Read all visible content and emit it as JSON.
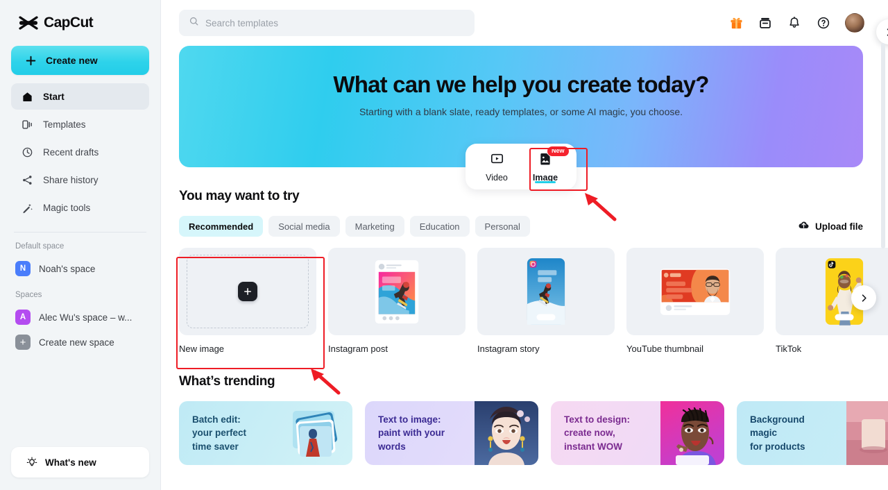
{
  "brand": {
    "name": "CapCut",
    "logo_icon": "capcut-logo-icon"
  },
  "sidebar": {
    "create_new": {
      "label": "Create new",
      "icon": "plus-icon"
    },
    "nav": [
      {
        "label": "Start",
        "icon": "home-icon",
        "active": true
      },
      {
        "label": "Templates",
        "icon": "templates-icon",
        "active": false
      },
      {
        "label": "Recent drafts",
        "icon": "clock-icon",
        "active": false
      },
      {
        "label": "Share history",
        "icon": "share-icon",
        "active": false
      },
      {
        "label": "Magic tools",
        "icon": "magic-wand-icon",
        "active": false
      }
    ],
    "default_space_label": "Default space",
    "default_space": {
      "label": "Noah's space",
      "initial": "N",
      "color": "#4a7dfb"
    },
    "spaces_label": "Spaces",
    "spaces": [
      {
        "label": "Alec Wu's space – w...",
        "initial": "A",
        "color": "#b44cf0"
      },
      {
        "label": "Create new space",
        "initial": "+",
        "color": "#8a9099"
      }
    ],
    "whats_new": {
      "label": "What's new",
      "icon": "lightbulb-icon"
    }
  },
  "header": {
    "search": {
      "placeholder": "Search templates",
      "value": "",
      "icon": "search-icon"
    },
    "actions": [
      {
        "name": "gift-icon",
        "label": "Gift"
      },
      {
        "name": "archive-icon",
        "label": "Archive"
      },
      {
        "name": "bell-icon",
        "label": "Notifications"
      },
      {
        "name": "help-icon",
        "label": "Help"
      }
    ],
    "avatar": {
      "name": "user-avatar"
    }
  },
  "hero": {
    "title": "What can we help you create today?",
    "subtitle": "Starting with a blank slate, ready templates, or some AI magic, you choose.",
    "gradient_from": "#4fd8ef",
    "gradient_to": "#a889f8",
    "modes": [
      {
        "label": "Video",
        "icon": "video-play-icon",
        "active": false,
        "badge": ""
      },
      {
        "label": "Image",
        "icon": "image-icon",
        "active": true,
        "badge": "New"
      }
    ]
  },
  "try_section": {
    "title": "You may want to try",
    "chips": [
      {
        "label": "Recommended",
        "active": true
      },
      {
        "label": "Social media",
        "active": false
      },
      {
        "label": "Marketing",
        "active": false
      },
      {
        "label": "Education",
        "active": false
      },
      {
        "label": "Personal",
        "active": false
      }
    ],
    "upload": {
      "label": "Upload file",
      "icon": "cloud-upload-icon"
    },
    "cards": [
      {
        "label": "New image",
        "kind": "new"
      },
      {
        "label": "Instagram post",
        "kind": "ig-post"
      },
      {
        "label": "Instagram story",
        "kind": "ig-story"
      },
      {
        "label": "YouTube thumbnail",
        "kind": "yt-thumb"
      },
      {
        "label": "TikTok",
        "kind": "tiktok"
      }
    ],
    "next_arrow": "chevron-right-icon"
  },
  "trending_section": {
    "title": "What’s trending",
    "cards": [
      {
        "text": "Batch edit:\nyour perfect\ntime saver",
        "bg_from": "#bfeaf5",
        "bg_to": "#d2f2f7",
        "fg": "#1a4f6e"
      },
      {
        "text": "Text to image:\npaint with your\nwords",
        "bg_from": "#dcd7fb",
        "bg_to": "#e6defb",
        "fg": "#3b2a93"
      },
      {
        "text": "Text to design:\ncreate now,\ninstant WOW",
        "bg_from": "#f6d9f2",
        "bg_to": "#eddbf8",
        "fg": "#7a2a8f"
      },
      {
        "text": "Background\nmagic\nfor products",
        "bg_from": "#bfe9f6",
        "bg_to": "#c9eef7",
        "fg": "#16486b"
      }
    ],
    "next_arrow": "chevron-right-icon"
  },
  "annotations": {
    "accent_color": "#ee1c25",
    "highlights": [
      {
        "name": "image-mode-highlight",
        "target": "Image"
      },
      {
        "name": "new-image-card-highlight",
        "target": "New image"
      }
    ]
  }
}
